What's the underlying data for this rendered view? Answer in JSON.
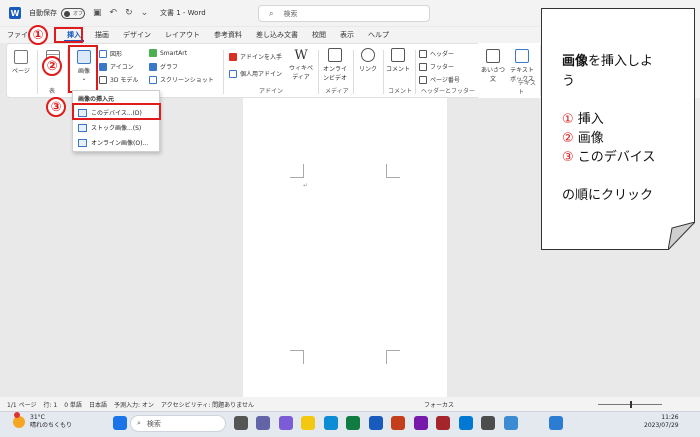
{
  "title_bar": {
    "app_letter": "W",
    "autosave_label": "自動保存",
    "autosave_state": "オフ",
    "doc_title": "文書 1 - Word",
    "search_placeholder": "検索"
  },
  "tabs": [
    "ファイル",
    "挿入",
    "描画",
    "デザイン",
    "レイアウト",
    "参考資料",
    "差し込み文書",
    "校閲",
    "表示",
    "ヘルプ"
  ],
  "ribbon": {
    "page_label": "ページ",
    "table_group": "表",
    "image_button": "画像",
    "shapes": "図形",
    "icons": "アイコン",
    "model3d": "3D モデル",
    "smartart": "SmartArt",
    "graph": "グラフ",
    "screenshot": "スクリーンショット",
    "addin_get": "アドインを入手",
    "addin_personal": "個人用アドイン",
    "wikipedia": "ウィキペディア",
    "addin_group": "アドイン",
    "online_video": "オンラインビデオ",
    "media_group": "メディア",
    "link": "リンク",
    "comment": "コメント",
    "comment_group": "コメント",
    "header": "ヘッダー",
    "footer": "フッター",
    "page_number": "ページ番号",
    "header_footer_group": "ヘッダーとフッター",
    "textbox": "テキストボックス",
    "wordart": "あいさつ文",
    "text_group": "テキスト"
  },
  "dropdown": {
    "header": "画像の挿入元",
    "items": [
      "このデバイス...(D)",
      "ストック画像...(S)",
      "オンライン画像(O)..."
    ]
  },
  "markers": [
    "①",
    "②",
    "③"
  ],
  "note": {
    "line1_bold": "画像",
    "line1_rest": "を挿入しよ",
    "line2": "う",
    "step1_num": "①",
    "step1": " 挿入",
    "step2_num": "②",
    "step2": " 画像",
    "step3_num": "③",
    "step3": " このデバイス",
    "closing": "の順にクリック"
  },
  "status_bar": {
    "page": "1/1 ページ",
    "line": "行: 1",
    "words": "0 単語",
    "lang": "日本語",
    "predict": "予測入力: オン",
    "accessibility": "アクセシビリティ: 問題ありません",
    "focus": "フォーカス"
  },
  "taskbar": {
    "temp": "31°C",
    "weather": "晴れのちくもり",
    "search": "検索",
    "time": "11:26",
    "date": "2023/07/29"
  },
  "colors": {
    "accent_red": "#e01b1b",
    "word_blue": "#185abd"
  }
}
